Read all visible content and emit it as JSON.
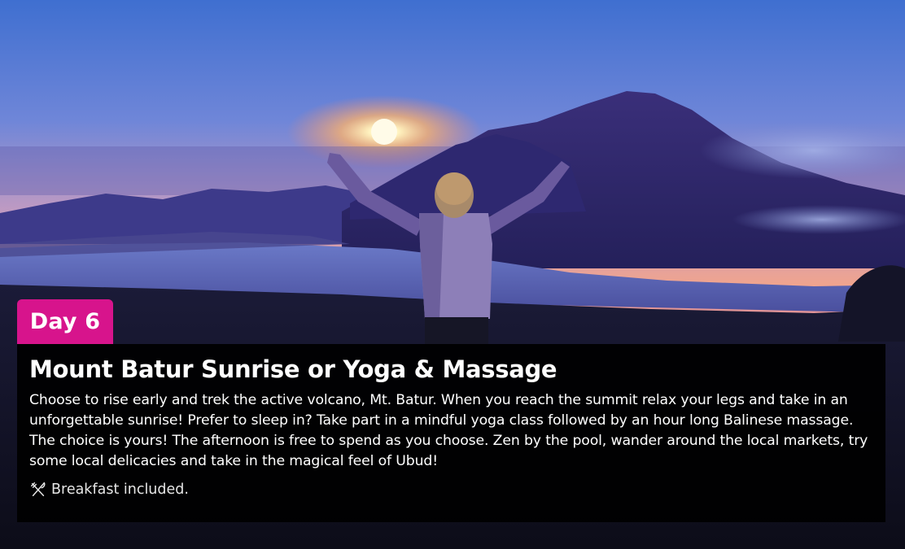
{
  "day": {
    "label": "Day 6",
    "accent_color": "#d7148c"
  },
  "title": "Mount Batur Sunrise or Yoga & Massage",
  "description": "Choose to rise early and trek the active volcano, Mt. Batur. When you reach the summit relax your legs and take in an unforgettable sunrise! Prefer to sleep in? Take part in a mindful yoga class followed by an hour long Balinese massage. The choice is yours! The afternoon is free to spend as you choose. Zen by the pool, wander around the local markets, try some local delicacies and take in the magical feel of Ubud!",
  "meals": {
    "icon": "fork-knife-icon",
    "text": "Breakfast included."
  }
}
